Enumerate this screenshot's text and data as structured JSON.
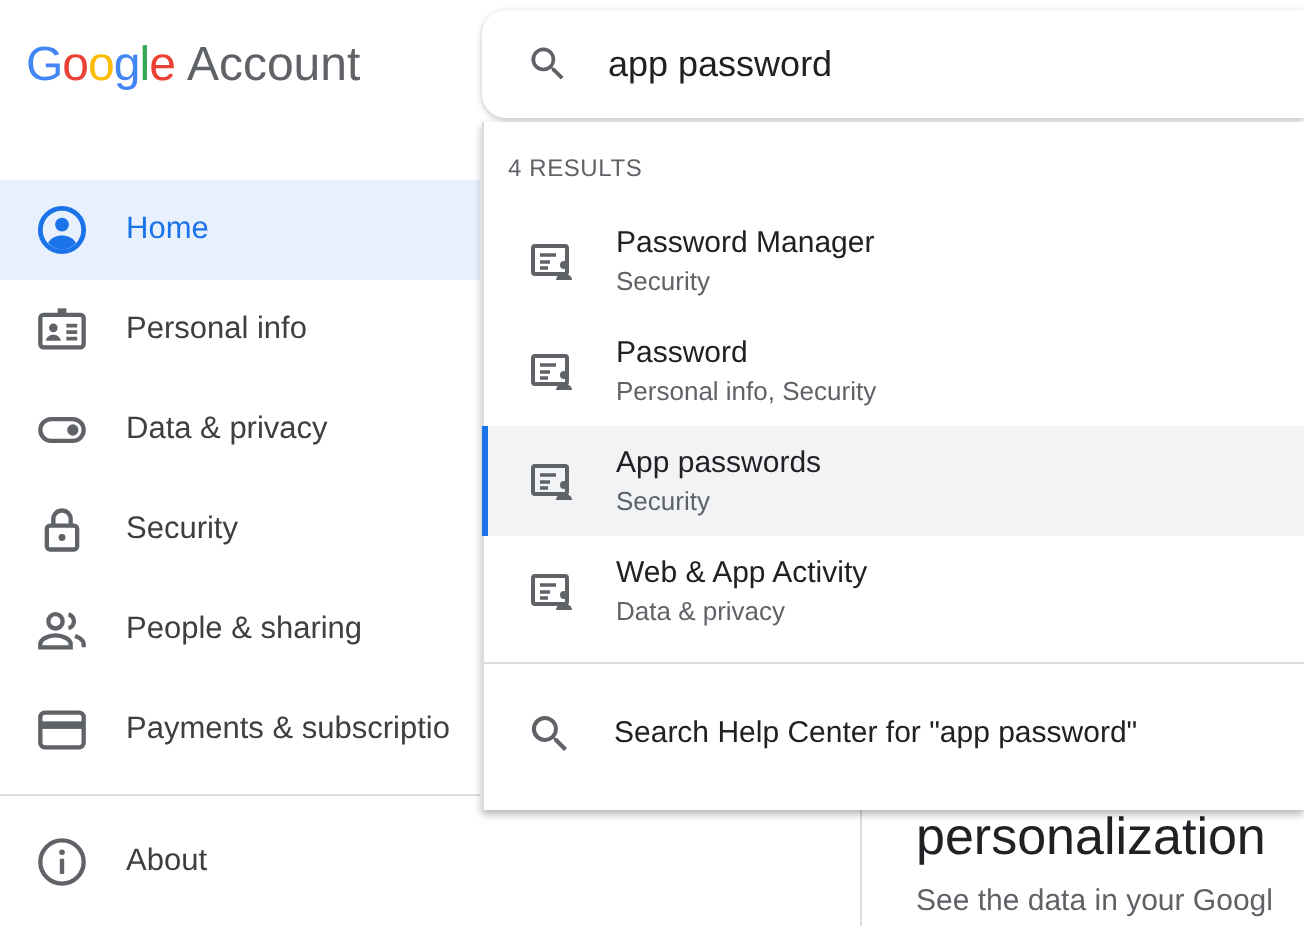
{
  "header": {
    "logo": "Google",
    "product": "Account"
  },
  "search": {
    "value": "app password"
  },
  "sidebar": {
    "items": [
      {
        "label": "Home",
        "selected": true
      },
      {
        "label": "Personal info",
        "selected": false
      },
      {
        "label": "Data & privacy",
        "selected": false
      },
      {
        "label": "Security",
        "selected": false
      },
      {
        "label": "People & sharing",
        "selected": false
      },
      {
        "label": "Payments & subscriptio",
        "selected": false
      }
    ],
    "footer_items": [
      {
        "label": "About",
        "selected": false
      }
    ]
  },
  "dropdown": {
    "count": "4 RESULTS",
    "results": [
      {
        "title": "Password Manager",
        "subtitle": "Security",
        "selected": false
      },
      {
        "title": "Password",
        "subtitle": "Personal info, Security",
        "selected": false
      },
      {
        "title": "App passwords",
        "subtitle": "Security",
        "selected": true
      },
      {
        "title": "Web & App Activity",
        "subtitle": "Data & privacy",
        "selected": false
      }
    ],
    "help": "Search Help Center for \"app password\""
  },
  "main": {
    "heading": "personalization",
    "text": "See the data in your Googl"
  }
}
